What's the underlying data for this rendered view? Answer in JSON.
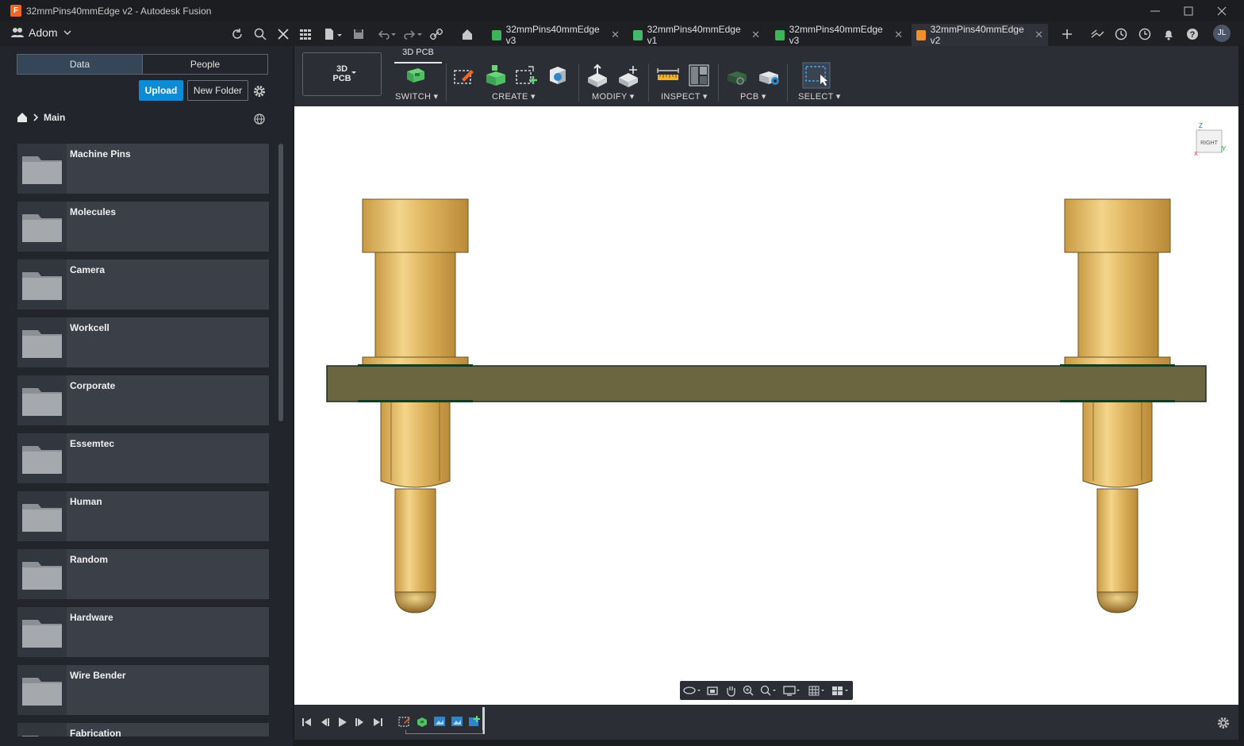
{
  "window": {
    "title": "32mmPins40mmEdge v2 - Autodesk Fusion"
  },
  "toolbar": {
    "team_name": "Adom",
    "user_initials": "JL"
  },
  "tabs": [
    {
      "label": "32mmPins40mmEdge v3",
      "type": "pcb",
      "active": false
    },
    {
      "label": "32mmPins40mmEdge v1",
      "type": "schematic",
      "active": false
    },
    {
      "label": "32mmPins40mmEdge v3",
      "type": "pcb",
      "active": false
    },
    {
      "label": "32mmPins40mmEdge v2",
      "type": "3d",
      "active": true
    }
  ],
  "data_panel": {
    "tab_data": "Data",
    "tab_people": "People",
    "upload_label": "Upload",
    "new_folder_label": "New Folder",
    "breadcrumb": "Main",
    "folders": [
      "Machine Pins",
      "Molecules",
      "Camera",
      "Workcell",
      "Corporate",
      "Essemtec",
      "Human",
      "Random",
      "Hardware",
      "Wire Bender",
      "Fabrication"
    ]
  },
  "ribbon": {
    "workspace_line1": "3D",
    "workspace_line2": "PCB",
    "active_tab": "3D PCB",
    "groups": {
      "switch": "SWITCH",
      "create": "CREATE",
      "modify": "MODIFY",
      "inspect": "INSPECT",
      "pcb": "PCB",
      "select": "SELECT"
    }
  },
  "viewport": {
    "viewcube_face": "RIGHT",
    "axis_z": "Z",
    "axis_y": "Y",
    "axis_x": "X"
  },
  "colors": {
    "accent": "#0f8ad4",
    "app_icon": "#f26522",
    "board": "#6b6540",
    "pin_gold": "#d9b35a"
  }
}
